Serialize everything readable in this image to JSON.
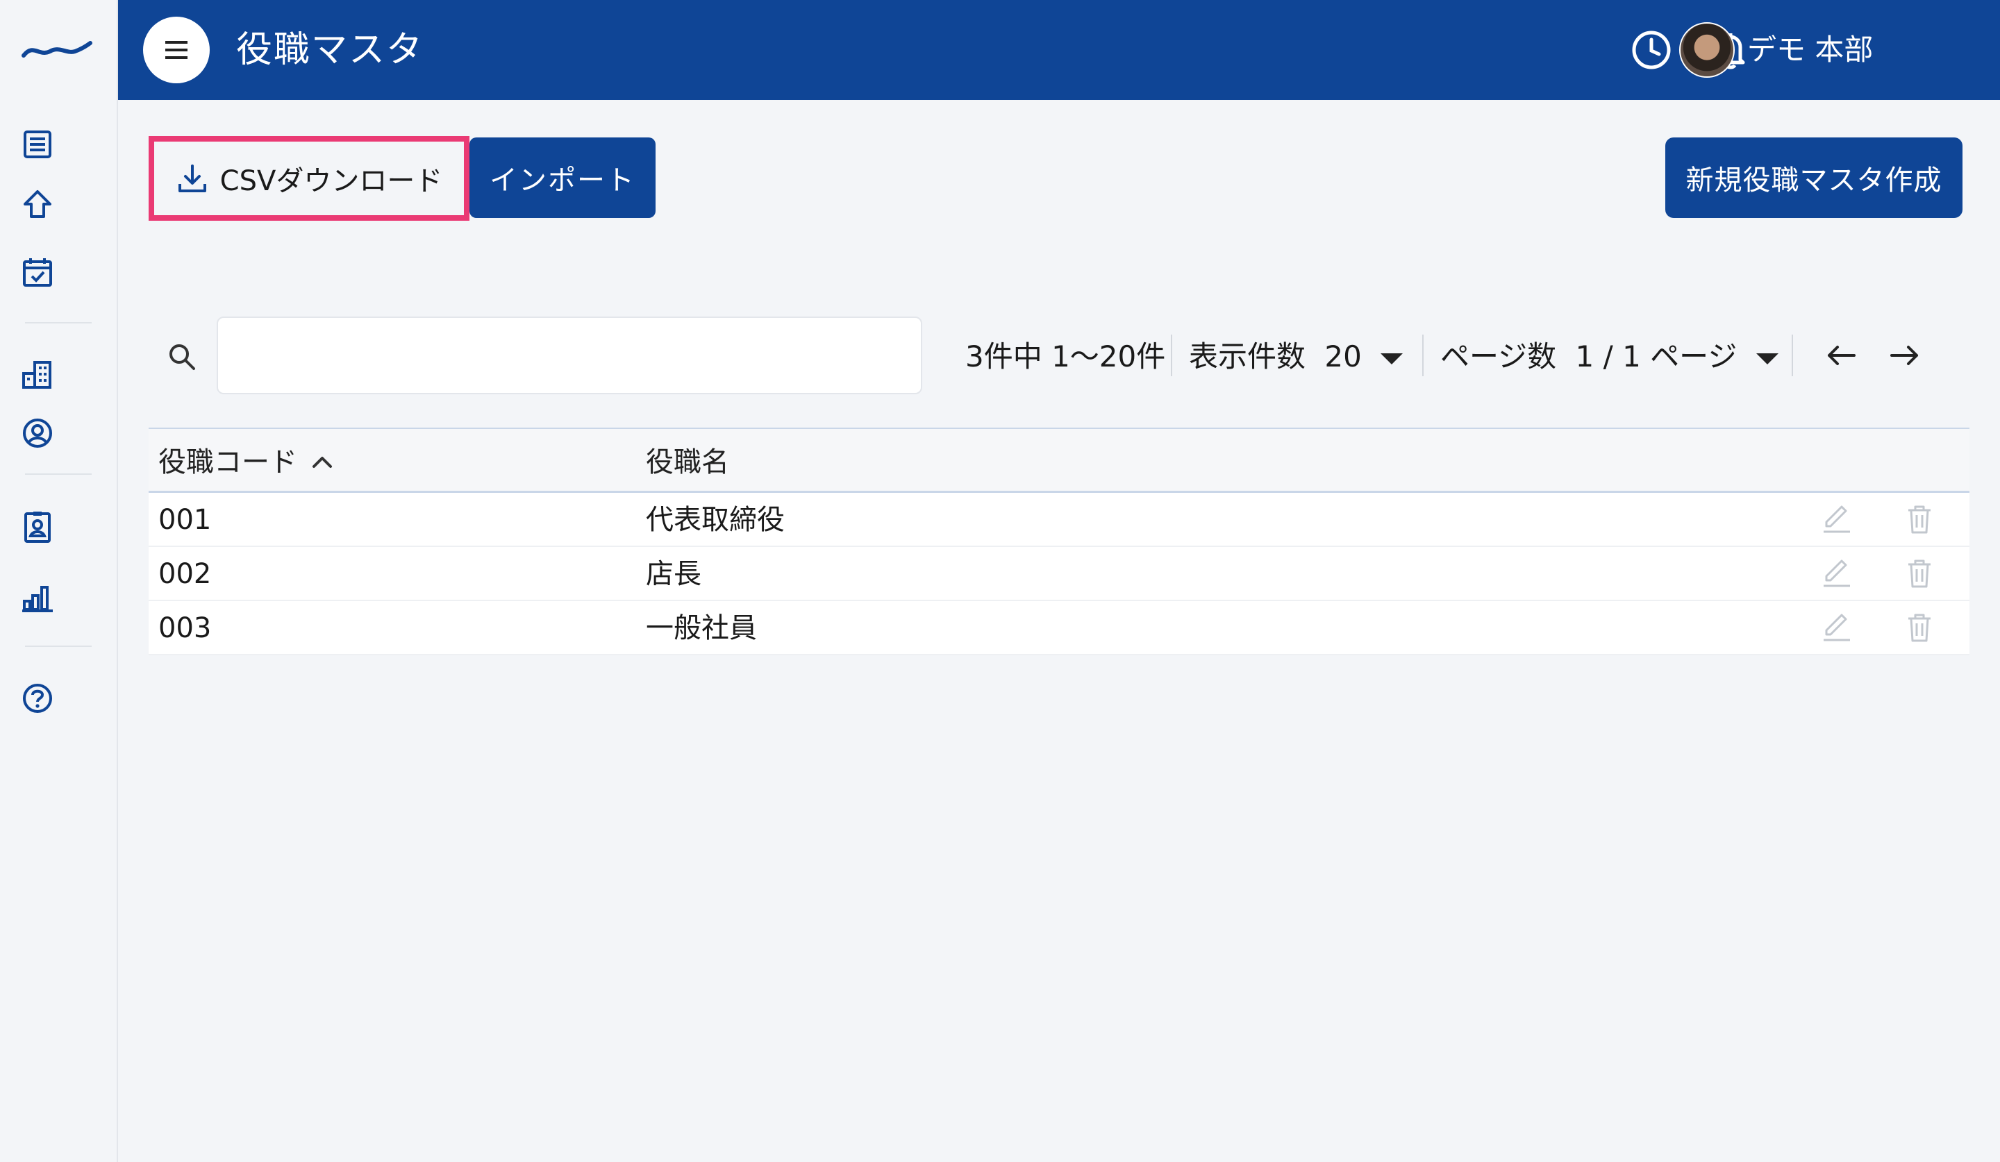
{
  "header": {
    "title": "役職マスタ",
    "user_name": "デモ 本部"
  },
  "toolbar": {
    "csv_download_label": "CSVダウンロード",
    "import_label": "インポート",
    "new_label": "新規役職マスタ作成"
  },
  "search": {
    "value": "",
    "placeholder": ""
  },
  "pagination": {
    "summary": "3件中 1〜20件",
    "per_page_label": "表示件数",
    "per_page_value": "20",
    "page_label": "ページ数",
    "page_value": "1 / 1 ページ",
    "prev_symbol": "←",
    "next_symbol": "→"
  },
  "table": {
    "columns": [
      {
        "label": "役職コード",
        "sorted": "asc"
      },
      {
        "label": "役職名"
      }
    ],
    "rows": [
      {
        "code": "001",
        "name": "代表取締役"
      },
      {
        "code": "002",
        "name": "店長"
      },
      {
        "code": "003",
        "name": "一般社員"
      }
    ]
  },
  "sidebar": {
    "items": [
      {
        "icon": "list-icon"
      },
      {
        "icon": "home-icon"
      },
      {
        "icon": "calendar-check-icon"
      },
      {
        "icon": "building-icon"
      },
      {
        "icon": "user-circle-icon"
      },
      {
        "icon": "id-card-icon"
      },
      {
        "icon": "bar-chart-icon"
      },
      {
        "icon": "help-icon"
      }
    ]
  },
  "colors": {
    "primary": "#0f4596",
    "highlight": "#ea3a74",
    "background": "#f3f5f8"
  }
}
